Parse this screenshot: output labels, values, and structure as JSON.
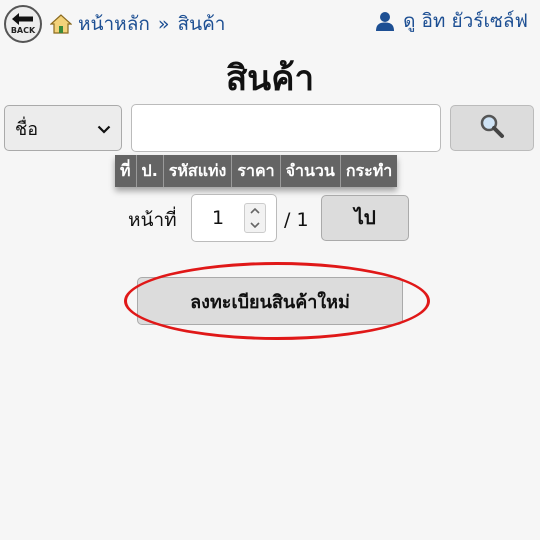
{
  "header": {
    "back_label": "BACK",
    "breadcrumb": {
      "home": "หน้าหลัก",
      "separator": "»",
      "current": "สินค้า"
    },
    "user_name": "ดู อิท ยัวร์เซล์ฟ"
  },
  "page_title": "สินค้า",
  "search": {
    "field_select_value": "ชื่อ",
    "input_value": "",
    "input_placeholder": ""
  },
  "table": {
    "columns": [
      "ที่",
      "ป.",
      "รหัสแท่ง",
      "ราคา",
      "จำนวน",
      "กระทำ"
    ]
  },
  "pagination": {
    "label": "หน้าที่",
    "current_page": "1",
    "total": "/ 1",
    "go_label": "ไป"
  },
  "register_button_label": "ลงทะเบียนสินค้าใหม่",
  "colors": {
    "link_blue": "#1d4f93",
    "header_gray": "#646464",
    "highlight_red": "#e01818"
  }
}
